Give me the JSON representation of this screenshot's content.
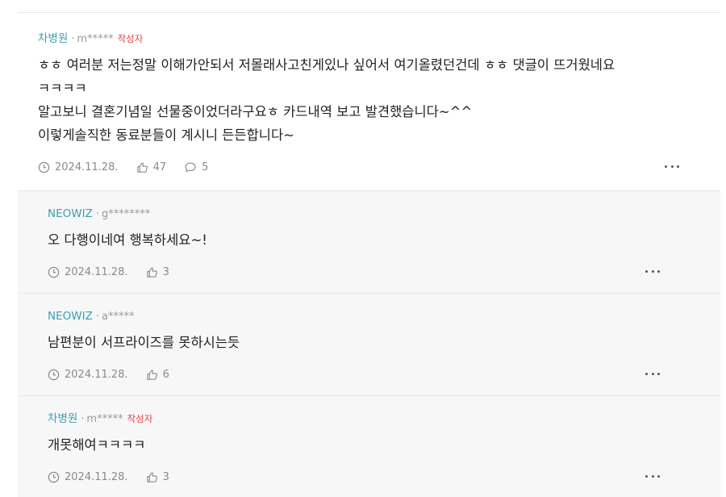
{
  "comments": [
    {
      "author": "차병원",
      "user_id": "m*****",
      "badge": "작성자",
      "lines": [
        "ㅎㅎ 여러분 저는정말 이해가안되서 저몰래사고친게있나 싶어서 여기올렸던건데 ㅎㅎ 댓글이 뜨거웠네요",
        "ㅋㅋㅋㅋ",
        "알고보니 결혼기념일 선물중이었더라구요ㅎ 카드내역 보고 발견했습니다~^^",
        "이렇게솔직한 동료분들이 계시니 든든합니다~"
      ],
      "date": "2024.11.28.",
      "likes": "47",
      "replies": "5"
    }
  ],
  "replies": [
    {
      "author": "NEOWIZ",
      "user_id": "g********",
      "badge": "",
      "text": "오 다행이네여 행복하세요~!",
      "date": "2024.11.28.",
      "likes": "3"
    },
    {
      "author": "NEOWIZ",
      "user_id": "a*****",
      "badge": "",
      "text": "남편분이 서프라이즈를 못하시는듯",
      "date": "2024.11.28.",
      "likes": "6"
    },
    {
      "author": "차병원",
      "user_id": "m*****",
      "badge": "작성자",
      "text": "개못해여ㅋㅋㅋㅋ",
      "date": "2024.11.28.",
      "likes": "3"
    }
  ],
  "icons": {
    "clock": "clock-icon",
    "like": "thumbs-up-icon",
    "reply": "speech-bubble-icon",
    "more": "more-dots-icon"
  },
  "colors": {
    "author": "#3a9fb3",
    "badge": "#e04848",
    "meta": "#8a8a8a",
    "reply_bg": "#f7f7f7"
  }
}
